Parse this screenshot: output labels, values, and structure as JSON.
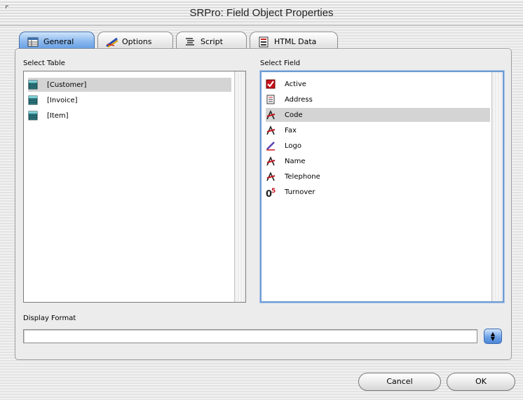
{
  "window": {
    "title": "SRPro: Field Object Properties"
  },
  "tabs": [
    {
      "label": "General",
      "icon": "table-grid-icon",
      "selected": true
    },
    {
      "label": "Options",
      "icon": "pencil-ruler-icon",
      "selected": false
    },
    {
      "label": "Script",
      "icon": "script-lines-icon",
      "selected": false
    },
    {
      "label": "HTML Data",
      "icon": "html-document-icon",
      "selected": false
    }
  ],
  "table_list": {
    "label": "Select Table",
    "items": [
      {
        "label": "[Customer]",
        "icon": "table-icon",
        "selected": true
      },
      {
        "label": "[Invoice]",
        "icon": "table-icon",
        "selected": false
      },
      {
        "label": "[Item]",
        "icon": "table-icon",
        "selected": false
      }
    ]
  },
  "field_list": {
    "label": "Select Field",
    "items": [
      {
        "label": "Active",
        "icon": "boolean-field-icon",
        "selected": false
      },
      {
        "label": "Address",
        "icon": "text-field-icon",
        "selected": false
      },
      {
        "label": "Code",
        "icon": "alpha-field-icon",
        "selected": true
      },
      {
        "label": "Fax",
        "icon": "alpha-field-icon",
        "selected": false
      },
      {
        "label": "Logo",
        "icon": "picture-field-icon",
        "selected": false
      },
      {
        "label": "Name",
        "icon": "alpha-field-icon",
        "selected": false
      },
      {
        "label": "Telephone",
        "icon": "alpha-field-icon",
        "selected": false
      },
      {
        "label": "Turnover",
        "icon": "real-number-field-icon",
        "selected": false
      }
    ]
  },
  "display_format": {
    "label": "Display Format",
    "value": "",
    "placeholder": ""
  },
  "buttons": {
    "cancel": "Cancel",
    "ok": "OK"
  },
  "colors": {
    "tab_selected": "#5a95df",
    "list_focus": "#6f9bd3",
    "selection": "#d4d4d4",
    "field_icon_red": "#c8141e"
  }
}
